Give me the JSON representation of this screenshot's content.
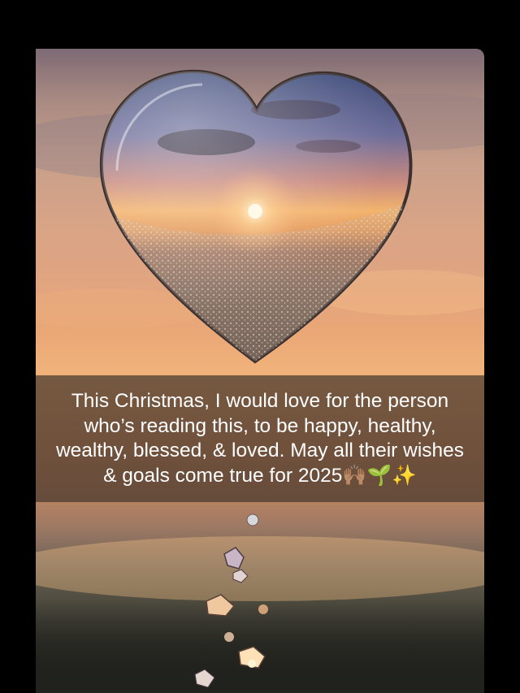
{
  "caption": {
    "text": "This Christmas, I would love for the person\nwho’s reading this, to be happy, healthy,\nwealthy, blessed, & loved. May all their wishes\n& goals come true for 2025🙌🏽🌱✨"
  },
  "icons": [
    "raising-hands-icon",
    "seedling-icon",
    "sparkles-icon"
  ]
}
